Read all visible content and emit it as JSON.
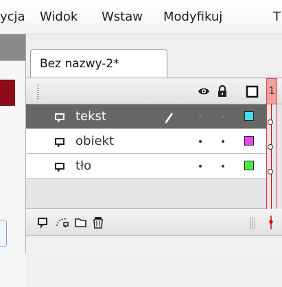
{
  "menubar": {
    "items": [
      "ycja",
      "Widok",
      "Wstaw",
      "Modyfikuj",
      "T"
    ]
  },
  "document": {
    "tab_label": "Bez nazwy-2*"
  },
  "timeline": {
    "header": {
      "eye_icon": "eye-icon",
      "lock_icon": "lock-icon",
      "outline_icon": "outline-square-icon",
      "frame_number": "1"
    },
    "layers": [
      {
        "name": "tekst",
        "selected": true,
        "color": "#44ddee",
        "editing": true
      },
      {
        "name": "obiekt",
        "selected": false,
        "color": "#ee44ee",
        "editing": false
      },
      {
        "name": "tło",
        "selected": false,
        "color": "#44ee44",
        "editing": false
      }
    ],
    "footer": {
      "icons": [
        "new-layer-icon",
        "motion-guide-icon",
        "folder-icon",
        "trash-icon"
      ]
    },
    "colors": {
      "playhead": "#e20000",
      "frame_highlight": "#f2a0a0",
      "selected_row": "#666666"
    }
  }
}
